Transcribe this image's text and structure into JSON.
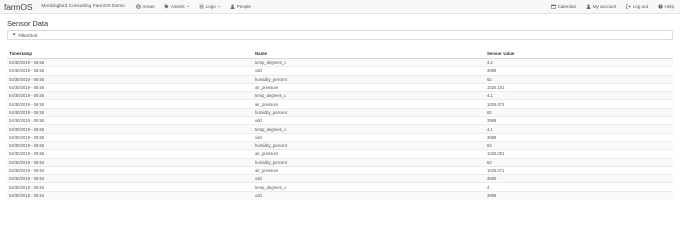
{
  "header": {
    "brand": "farmOS",
    "site_name": "Mockingbird Consulting FarmOS Demo",
    "nav_left": [
      {
        "id": "areas",
        "label": "Areas",
        "icon": "globe-icon",
        "dropdown": false
      },
      {
        "id": "assets",
        "label": "Assets",
        "icon": "tag-icon",
        "dropdown": true
      },
      {
        "id": "logs",
        "label": "Logs",
        "icon": "list-icon",
        "dropdown": true
      },
      {
        "id": "people",
        "label": "People",
        "icon": "user-icon",
        "dropdown": false
      }
    ],
    "nav_right": [
      {
        "id": "calendar",
        "label": "Calendar",
        "icon": "calendar-icon"
      },
      {
        "id": "account",
        "label": "My account",
        "icon": "user-icon"
      },
      {
        "id": "logout",
        "label": "Log out",
        "icon": "logout-icon"
      },
      {
        "id": "help",
        "label": "Help",
        "icon": "help-icon"
      }
    ]
  },
  "page": {
    "title": "Sensor Data",
    "filter_label": "Filter/Sort"
  },
  "table": {
    "columns": [
      "Timestamp",
      "Name",
      "Sensor value"
    ],
    "rows": [
      [
        "04/30/2019 - 06:56",
        "temp_degrees_c",
        "4.2"
      ],
      [
        "04/30/2019 - 06:56",
        "vdd",
        "3599"
      ],
      [
        "04/30/2019 - 06:56",
        "humidity_percent",
        "62"
      ],
      [
        "04/30/2019 - 06:56",
        "air_pressure",
        "1025.151"
      ],
      [
        "04/30/2019 - 06:55",
        "temp_degrees_c",
        "4.1"
      ],
      [
        "04/30/2019 - 06:55",
        "air_pressure",
        "1025.074"
      ],
      [
        "04/30/2019 - 06:55",
        "humidity_percent",
        "62"
      ],
      [
        "04/30/2019 - 06:55",
        "vdd",
        "3599"
      ],
      [
        "04/30/2019 - 06:55",
        "temp_degrees_c",
        "4.1"
      ],
      [
        "04/30/2019 - 06:55",
        "vdd",
        "3599"
      ],
      [
        "04/30/2019 - 06:55",
        "humidity_percent",
        "62"
      ],
      [
        "04/30/2019 - 06:55",
        "air_pressure",
        "1025.001"
      ],
      [
        "04/30/2019 - 06:54",
        "humidity_percent",
        "62"
      ],
      [
        "04/30/2019 - 06:54",
        "air_pressure",
        "1025.071"
      ],
      [
        "04/30/2019 - 06:54",
        "vdd",
        "3599"
      ],
      [
        "04/30/2019 - 06:54",
        "temp_degrees_c",
        "4"
      ],
      [
        "04/30/2019 - 06:54",
        "vdd",
        "3599"
      ]
    ]
  },
  "colors": {
    "navbar_bg": "#f8f8f8",
    "text": "#333333",
    "row_stripe": "#f9f9f9",
    "border": "#dcdcdc"
  }
}
